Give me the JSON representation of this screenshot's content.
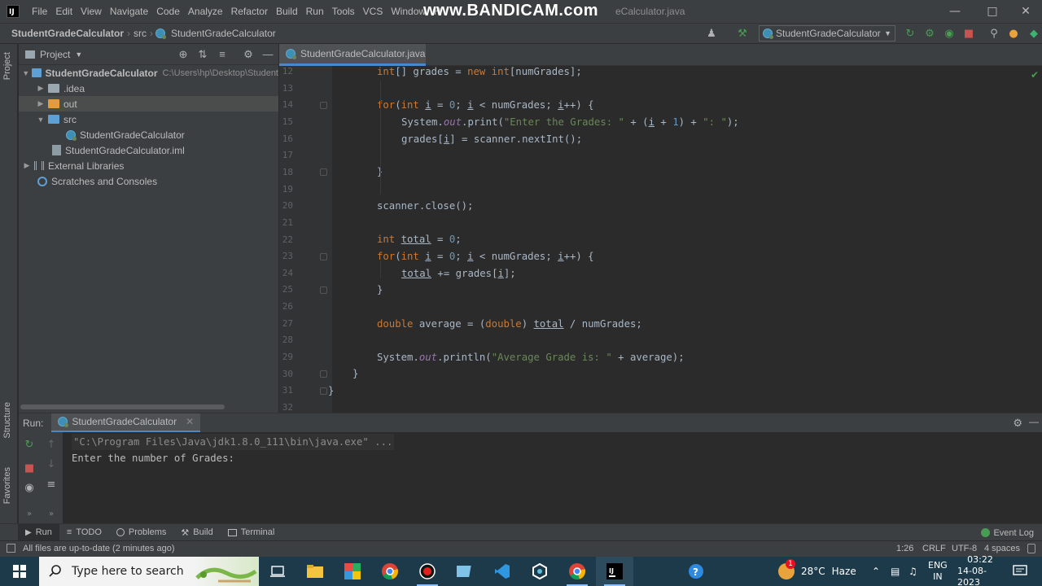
{
  "menu": {
    "items": [
      "File",
      "Edit",
      "View",
      "Navigate",
      "Code",
      "Analyze",
      "Refactor",
      "Build",
      "Run",
      "Tools",
      "VCS",
      "Window"
    ],
    "partial_item": "H"
  },
  "watermark": "www.BANDICAM.com",
  "window_title": "eCalculator.java",
  "navbar": {
    "project": "StudentGradeCalculator",
    "folder": "src",
    "file": "StudentGradeCalculator"
  },
  "run_config": {
    "label": "StudentGradeCalculator"
  },
  "sidebar_strip": {
    "project_label": "Project",
    "structure_label": "Structure",
    "favorites_label": "Favorites"
  },
  "project_panel": {
    "title": "Project",
    "tree": [
      {
        "label": "StudentGradeCalculator",
        "hint": "C:\\Users\\hp\\Desktop\\Student",
        "bold": true,
        "arrow": "▾",
        "icon": "folder-icon",
        "indent": 0
      },
      {
        "label": ".idea",
        "arrow": "▸",
        "icon": "folder-icon",
        "indent": 1
      },
      {
        "label": "out",
        "arrow": "▸",
        "icon": "folder-icon",
        "indent": 1,
        "selected": true
      },
      {
        "label": "src",
        "arrow": "▾",
        "icon": "source-folder-icon",
        "indent": 1
      },
      {
        "label": "StudentGradeCalculator",
        "icon": "java-class-icon",
        "indent": 2
      },
      {
        "label": "StudentGradeCalculator.iml",
        "icon": "iml-file-icon",
        "indent": 1
      },
      {
        "label": "External Libraries",
        "arrow": "▸",
        "icon": "library-icon",
        "indent": 0
      },
      {
        "label": "Scratches and Consoles",
        "icon": "scratches-icon",
        "indent": 0
      }
    ]
  },
  "editor": {
    "tab_label": "StudentGradeCalculator.java",
    "line_numbers": [
      "12",
      "13",
      "14",
      "15",
      "16",
      "17",
      "18",
      "19",
      "20",
      "21",
      "22",
      "23",
      "24",
      "25",
      "26",
      "27",
      "28",
      "29",
      "30",
      "31",
      "32"
    ]
  },
  "run_panel": {
    "label": "Run:",
    "tab_label": "StudentGradeCalculator",
    "console_lines": [
      "\"C:\\Program Files\\Java\\jdk1.8.0_111\\bin\\java.exe\" ...",
      "Enter the number of Grades:"
    ]
  },
  "bottom_tabs": {
    "run": "Run",
    "todo": "TODO",
    "problems": "Problems",
    "build": "Build",
    "terminal": "Terminal",
    "event_log": "Event Log"
  },
  "status_bar": {
    "message": "All files are up-to-date (2 minutes ago)",
    "position": "1:26",
    "line_sep": "CRLF",
    "encoding": "UTF-8",
    "indent": "4 spaces"
  },
  "taskbar": {
    "search_placeholder": "Type here to search",
    "weather_temp": "28°C",
    "weather_desc": "Haze",
    "lang_line1": "ENG",
    "lang_line2": "IN",
    "time": "03:22",
    "date": "14-08-2023",
    "notification_count": "1"
  },
  "colors": {
    "keyword": "#cc7832",
    "string": "#6a8759",
    "number": "#6897bb",
    "static_field": "#9876aa",
    "text": "#a9b7c6",
    "accent": "#4a88c7"
  }
}
